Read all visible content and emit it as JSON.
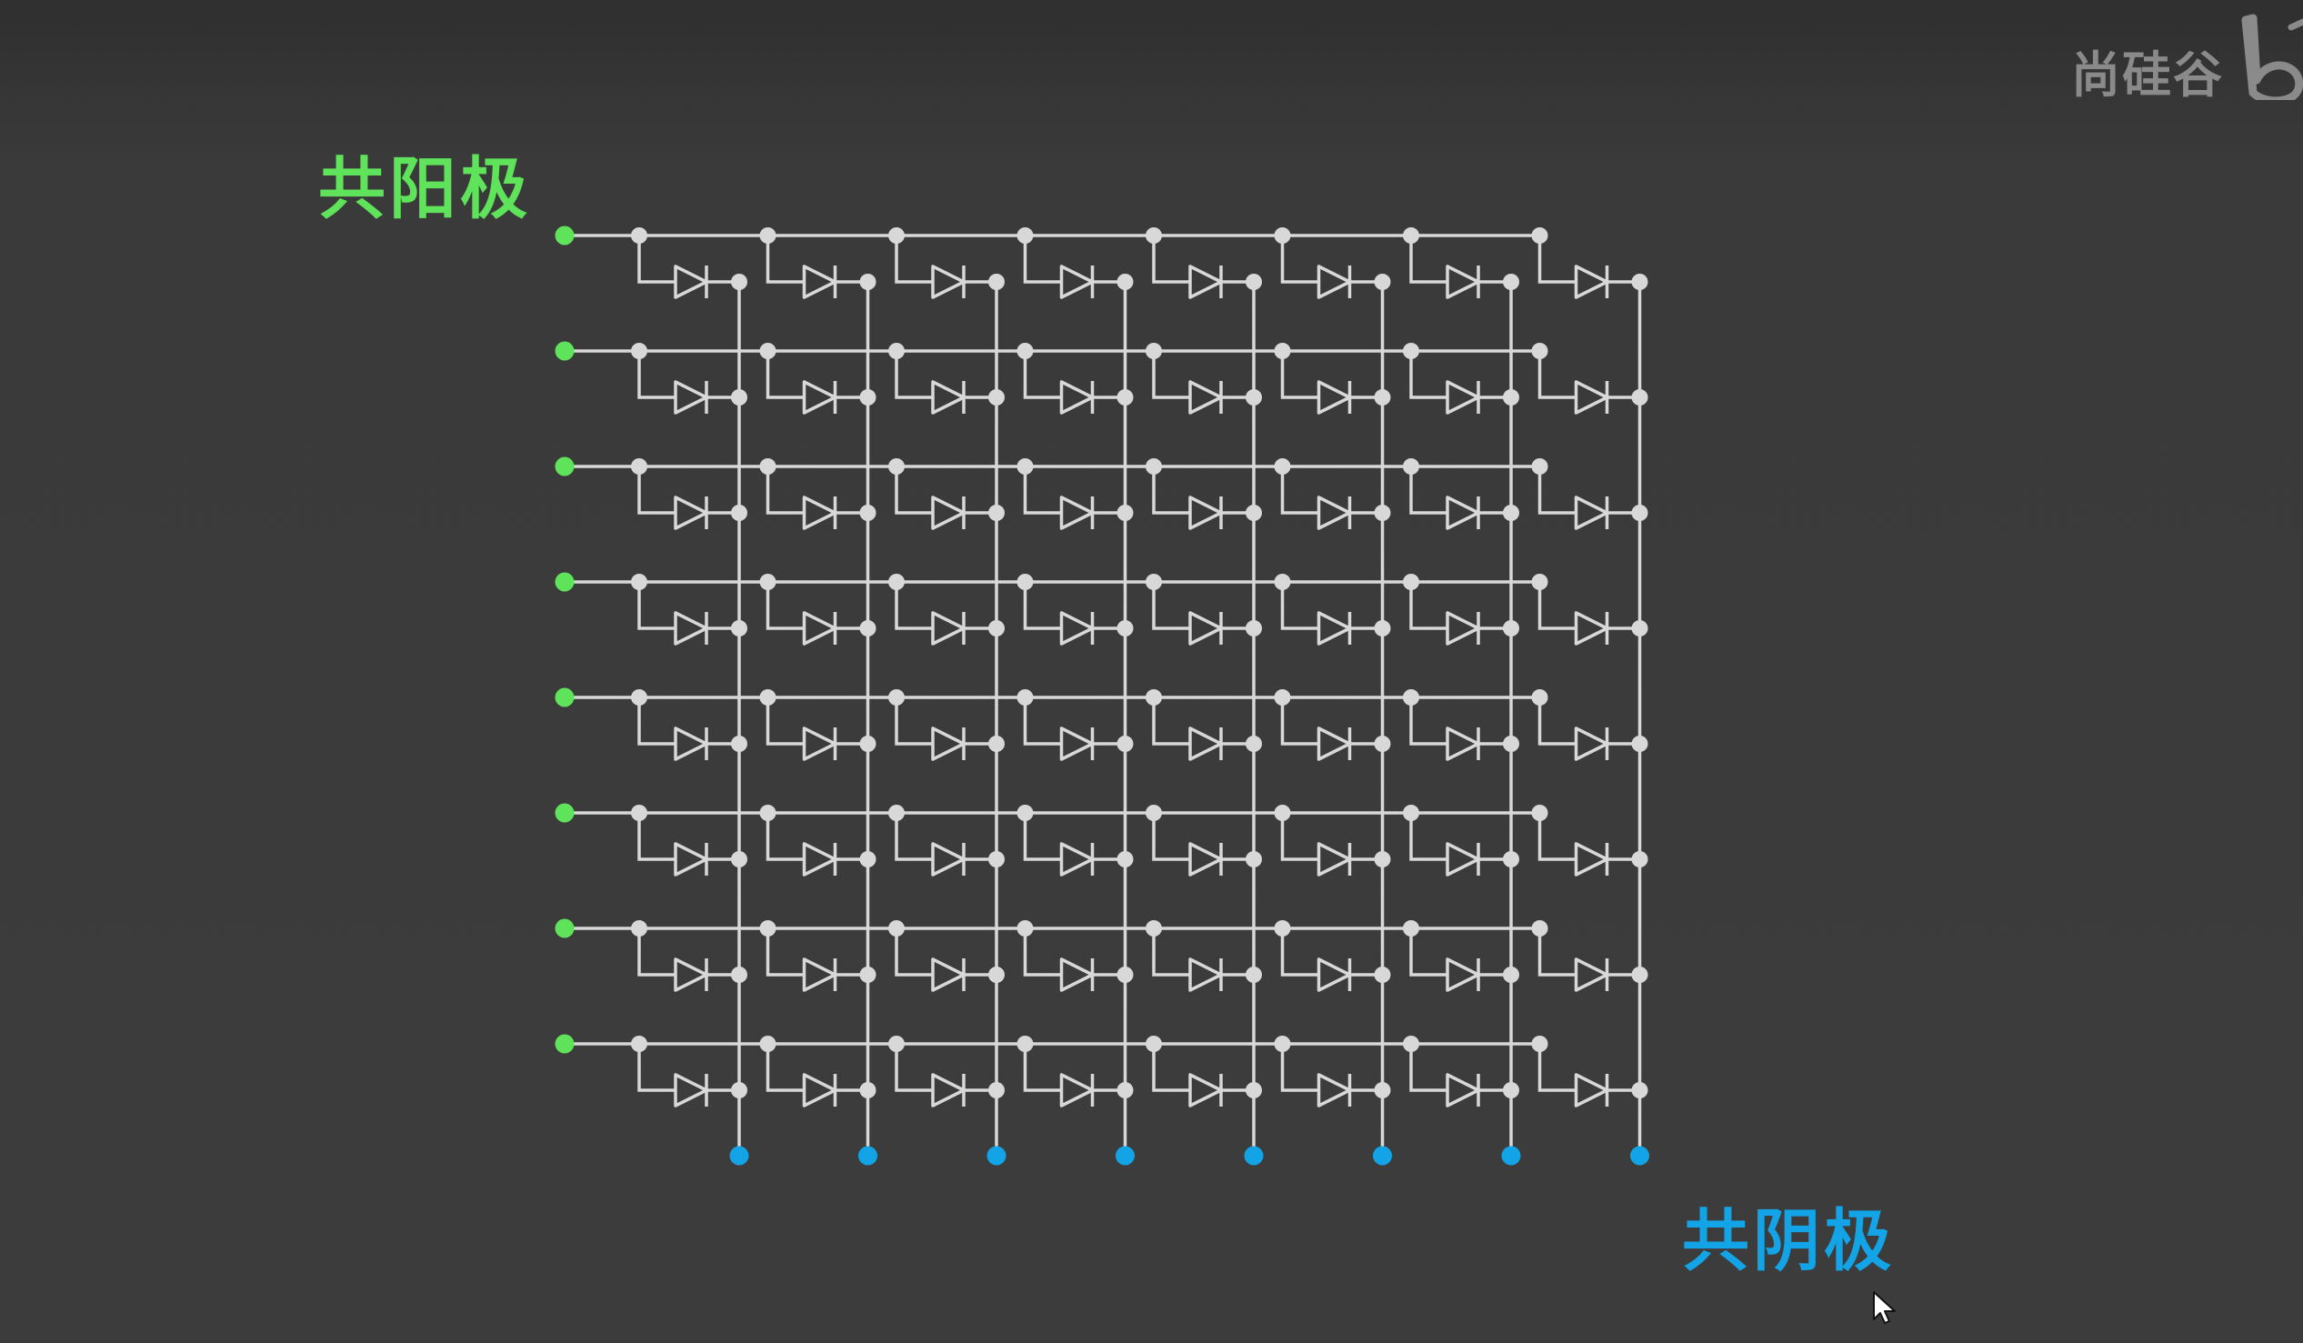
{
  "diagram": {
    "anode_label": "共阳极",
    "cathode_label": "共阴极",
    "rows": 8,
    "columns": 8,
    "colors": {
      "anode": "#5fe35a",
      "cathode": "#12a4e6",
      "wire": "#d8d8d8",
      "background": "#3c3c3c"
    }
  },
  "watermark": {
    "text": "尚硅谷",
    "logo_icon": "bilibili-logo-icon"
  },
  "cursor": {
    "icon": "mouse-pointer-icon"
  }
}
